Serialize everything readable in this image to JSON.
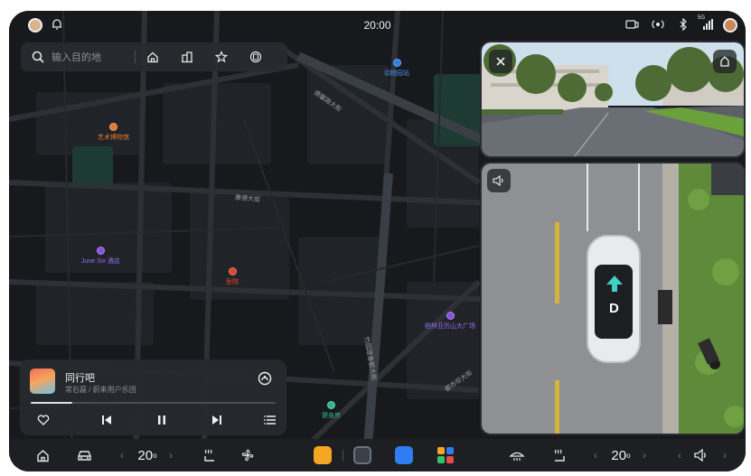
{
  "status_bar": {
    "time": "20:00",
    "signal_label": "5G"
  },
  "search": {
    "placeholder": "输入目的地"
  },
  "map": {
    "road_labels": [
      "德馨路大街",
      "康德大街",
      "竹园路春都大街",
      "都市坝大街"
    ],
    "pois": [
      {
        "name": "动物园站",
        "color": "#2f7de1"
      },
      {
        "name": "艺术博物馆",
        "color": "#e07a2d"
      },
      {
        "name": "June Six 酒店",
        "color": "#8a4fe0"
      },
      {
        "name": "医院",
        "color": "#e0452d"
      },
      {
        "name": "柏林亚历山大广场",
        "color": "#8a4fe0"
      },
      {
        "name": "健身房",
        "color": "#2fb58a"
      }
    ]
  },
  "camera": {
    "gear": "D"
  },
  "music": {
    "title": "同行吧",
    "artist": "常石磊 / 蔚来用户乐团",
    "progress": 0.17
  },
  "dock": {
    "left_temp": "20",
    "left_temp_unit": "o",
    "right_temp": "20",
    "right_temp_unit": "o",
    "chevron_left": "‹",
    "chevron_right": "›"
  },
  "colors": {
    "accent_arrow": "#3fd0c5",
    "app_orange": "#f5a623",
    "app_blue": "#2e7df2"
  },
  "icons": [
    "home-icon",
    "car-icon",
    "seat-heat-icon",
    "fan-icon",
    "defrost-icon",
    "volume-icon",
    "close-icon",
    "heart-icon",
    "previous-icon",
    "pause-icon",
    "next-icon",
    "playlist-icon"
  ]
}
